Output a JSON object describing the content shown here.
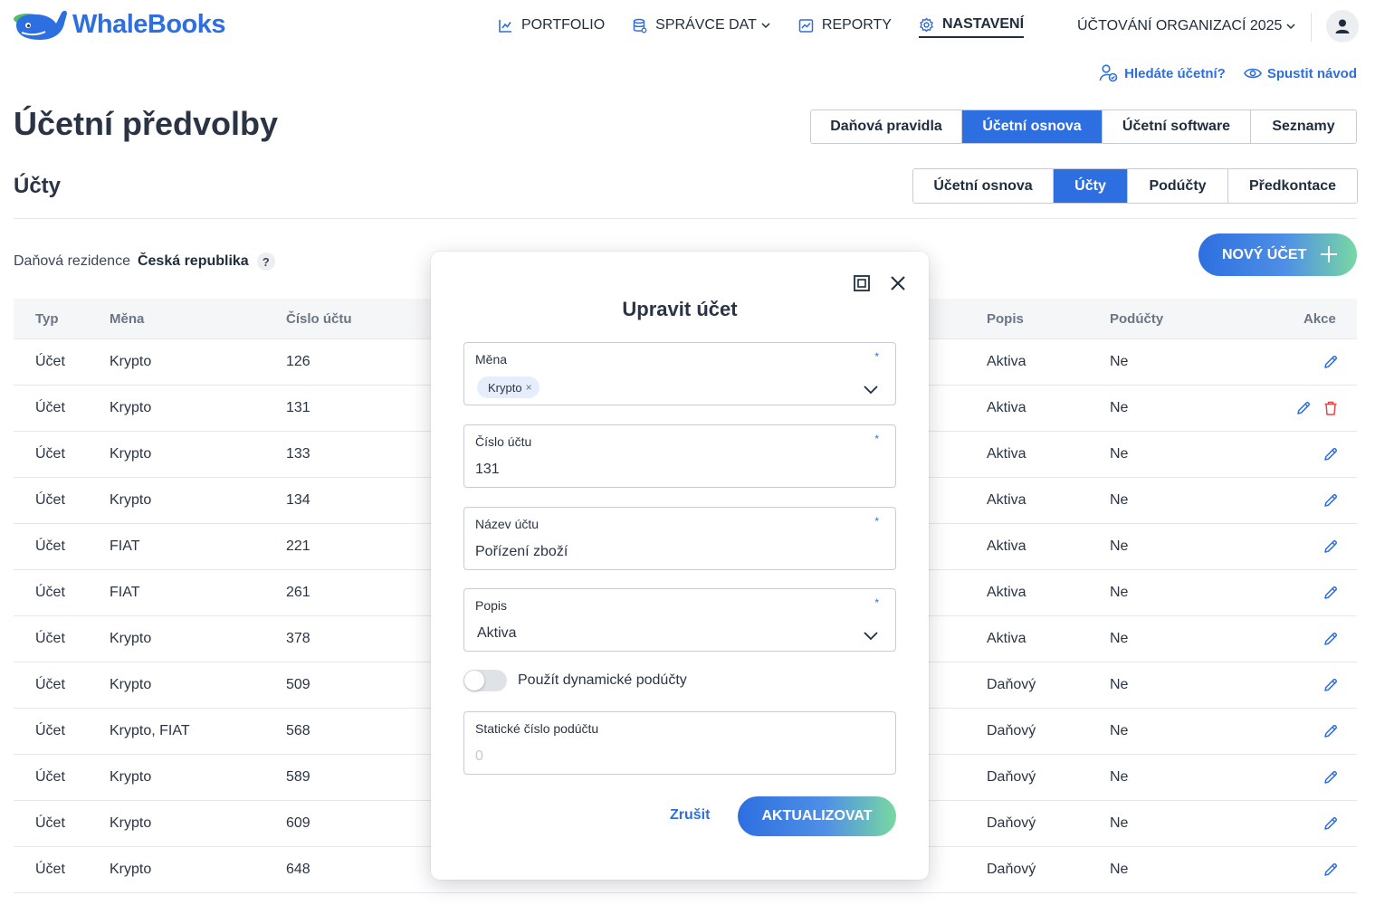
{
  "brand": {
    "name": "WhaleBooks",
    "color": "#2d6fe0"
  },
  "nav": {
    "items": [
      {
        "label": "PORTFOLIO",
        "icon": "chart-line-icon"
      },
      {
        "label": "SPRÁVCE DAT",
        "icon": "database-icon"
      },
      {
        "label": "REPORTY",
        "icon": "report-icon"
      },
      {
        "label": "NASTAVENÍ",
        "icon": "gear-icon"
      }
    ],
    "organization": "ÚČTOVÁNÍ ORGANIZACÍ 2025"
  },
  "help": {
    "find_accountant": "Hledáte účetní?",
    "start_guide": "Spustit návod"
  },
  "page": {
    "title": "Účetní předvolby",
    "tabs_main": [
      "Daňová pravidla",
      "Účetní osnova",
      "Účetní software",
      "Seznamy"
    ],
    "tabs_main_active": "Účetní osnova",
    "section_title": "Účty",
    "tabs_sub": [
      "Účetní osnova",
      "Účty",
      "Podúčty",
      "Předkontace"
    ],
    "tabs_sub_active": "Účty",
    "tax_residence_label": "Daňová rezidence",
    "tax_residence_value": "Česká republika",
    "help_mark": "?",
    "new_account_button": "NOVÝ ÚČET"
  },
  "table": {
    "columns": [
      "Typ",
      "Měna",
      "Číslo účtu",
      "Popis",
      "Podúčty",
      "Akce"
    ],
    "rows": [
      {
        "typ": "Účet",
        "mena": "Krypto",
        "cislo": "126",
        "popis": "Aktiva",
        "poducty": "Ne",
        "delete": false
      },
      {
        "typ": "Účet",
        "mena": "Krypto",
        "cislo": "131",
        "popis": "Aktiva",
        "poducty": "Ne",
        "delete": true
      },
      {
        "typ": "Účet",
        "mena": "Krypto",
        "cislo": "133",
        "popis": "Aktiva",
        "poducty": "Ne",
        "delete": false
      },
      {
        "typ": "Účet",
        "mena": "Krypto",
        "cislo": "134",
        "popis": "Aktiva",
        "poducty": "Ne",
        "delete": false
      },
      {
        "typ": "Účet",
        "mena": "FIAT",
        "cislo": "221",
        "popis": "Aktiva",
        "poducty": "Ne",
        "delete": false
      },
      {
        "typ": "Účet",
        "mena": "FIAT",
        "cislo": "261",
        "popis": "Aktiva",
        "poducty": "Ne",
        "delete": false
      },
      {
        "typ": "Účet",
        "mena": "Krypto",
        "cislo": "378",
        "popis": "Aktiva",
        "poducty": "Ne",
        "delete": false
      },
      {
        "typ": "Účet",
        "mena": "Krypto",
        "cislo": "509",
        "popis": "Daňový",
        "poducty": "Ne",
        "delete": false
      },
      {
        "typ": "Účet",
        "mena": "Krypto, FIAT",
        "cislo": "568",
        "popis": "Daňový",
        "poducty": "Ne",
        "delete": false
      },
      {
        "typ": "Účet",
        "mena": "Krypto",
        "cislo": "589",
        "popis": "Daňový",
        "poducty": "Ne",
        "delete": false
      },
      {
        "typ": "Účet",
        "mena": "Krypto",
        "cislo": "609",
        "popis": "Daňový",
        "poducty": "Ne",
        "delete": false
      },
      {
        "typ": "Účet",
        "mena": "Krypto",
        "cislo": "648",
        "popis": "Daňový",
        "poducty": "Ne",
        "delete": false
      }
    ]
  },
  "modal": {
    "title": "Upravit účet",
    "required_mark": "*",
    "currency": {
      "label": "Měna",
      "chip": "Krypto",
      "chip_remove": "×"
    },
    "account_number": {
      "label": "Číslo účtu",
      "value": "131"
    },
    "account_name": {
      "label": "Název účtu",
      "value": "Pořízení zboží"
    },
    "description": {
      "label": "Popis",
      "value": "Aktiva"
    },
    "dynamic_toggle": {
      "label": "Použít dynamické podúčty",
      "on": false
    },
    "static_sub": {
      "label": "Statické číslo podúčtu",
      "placeholder": "0"
    },
    "cancel": "Zrušit",
    "submit": "AKTUALIZOVAT"
  },
  "colors": {
    "accent": "#2d6fe0",
    "danger": "#e04848",
    "gradient_end": "#78d8a2"
  }
}
